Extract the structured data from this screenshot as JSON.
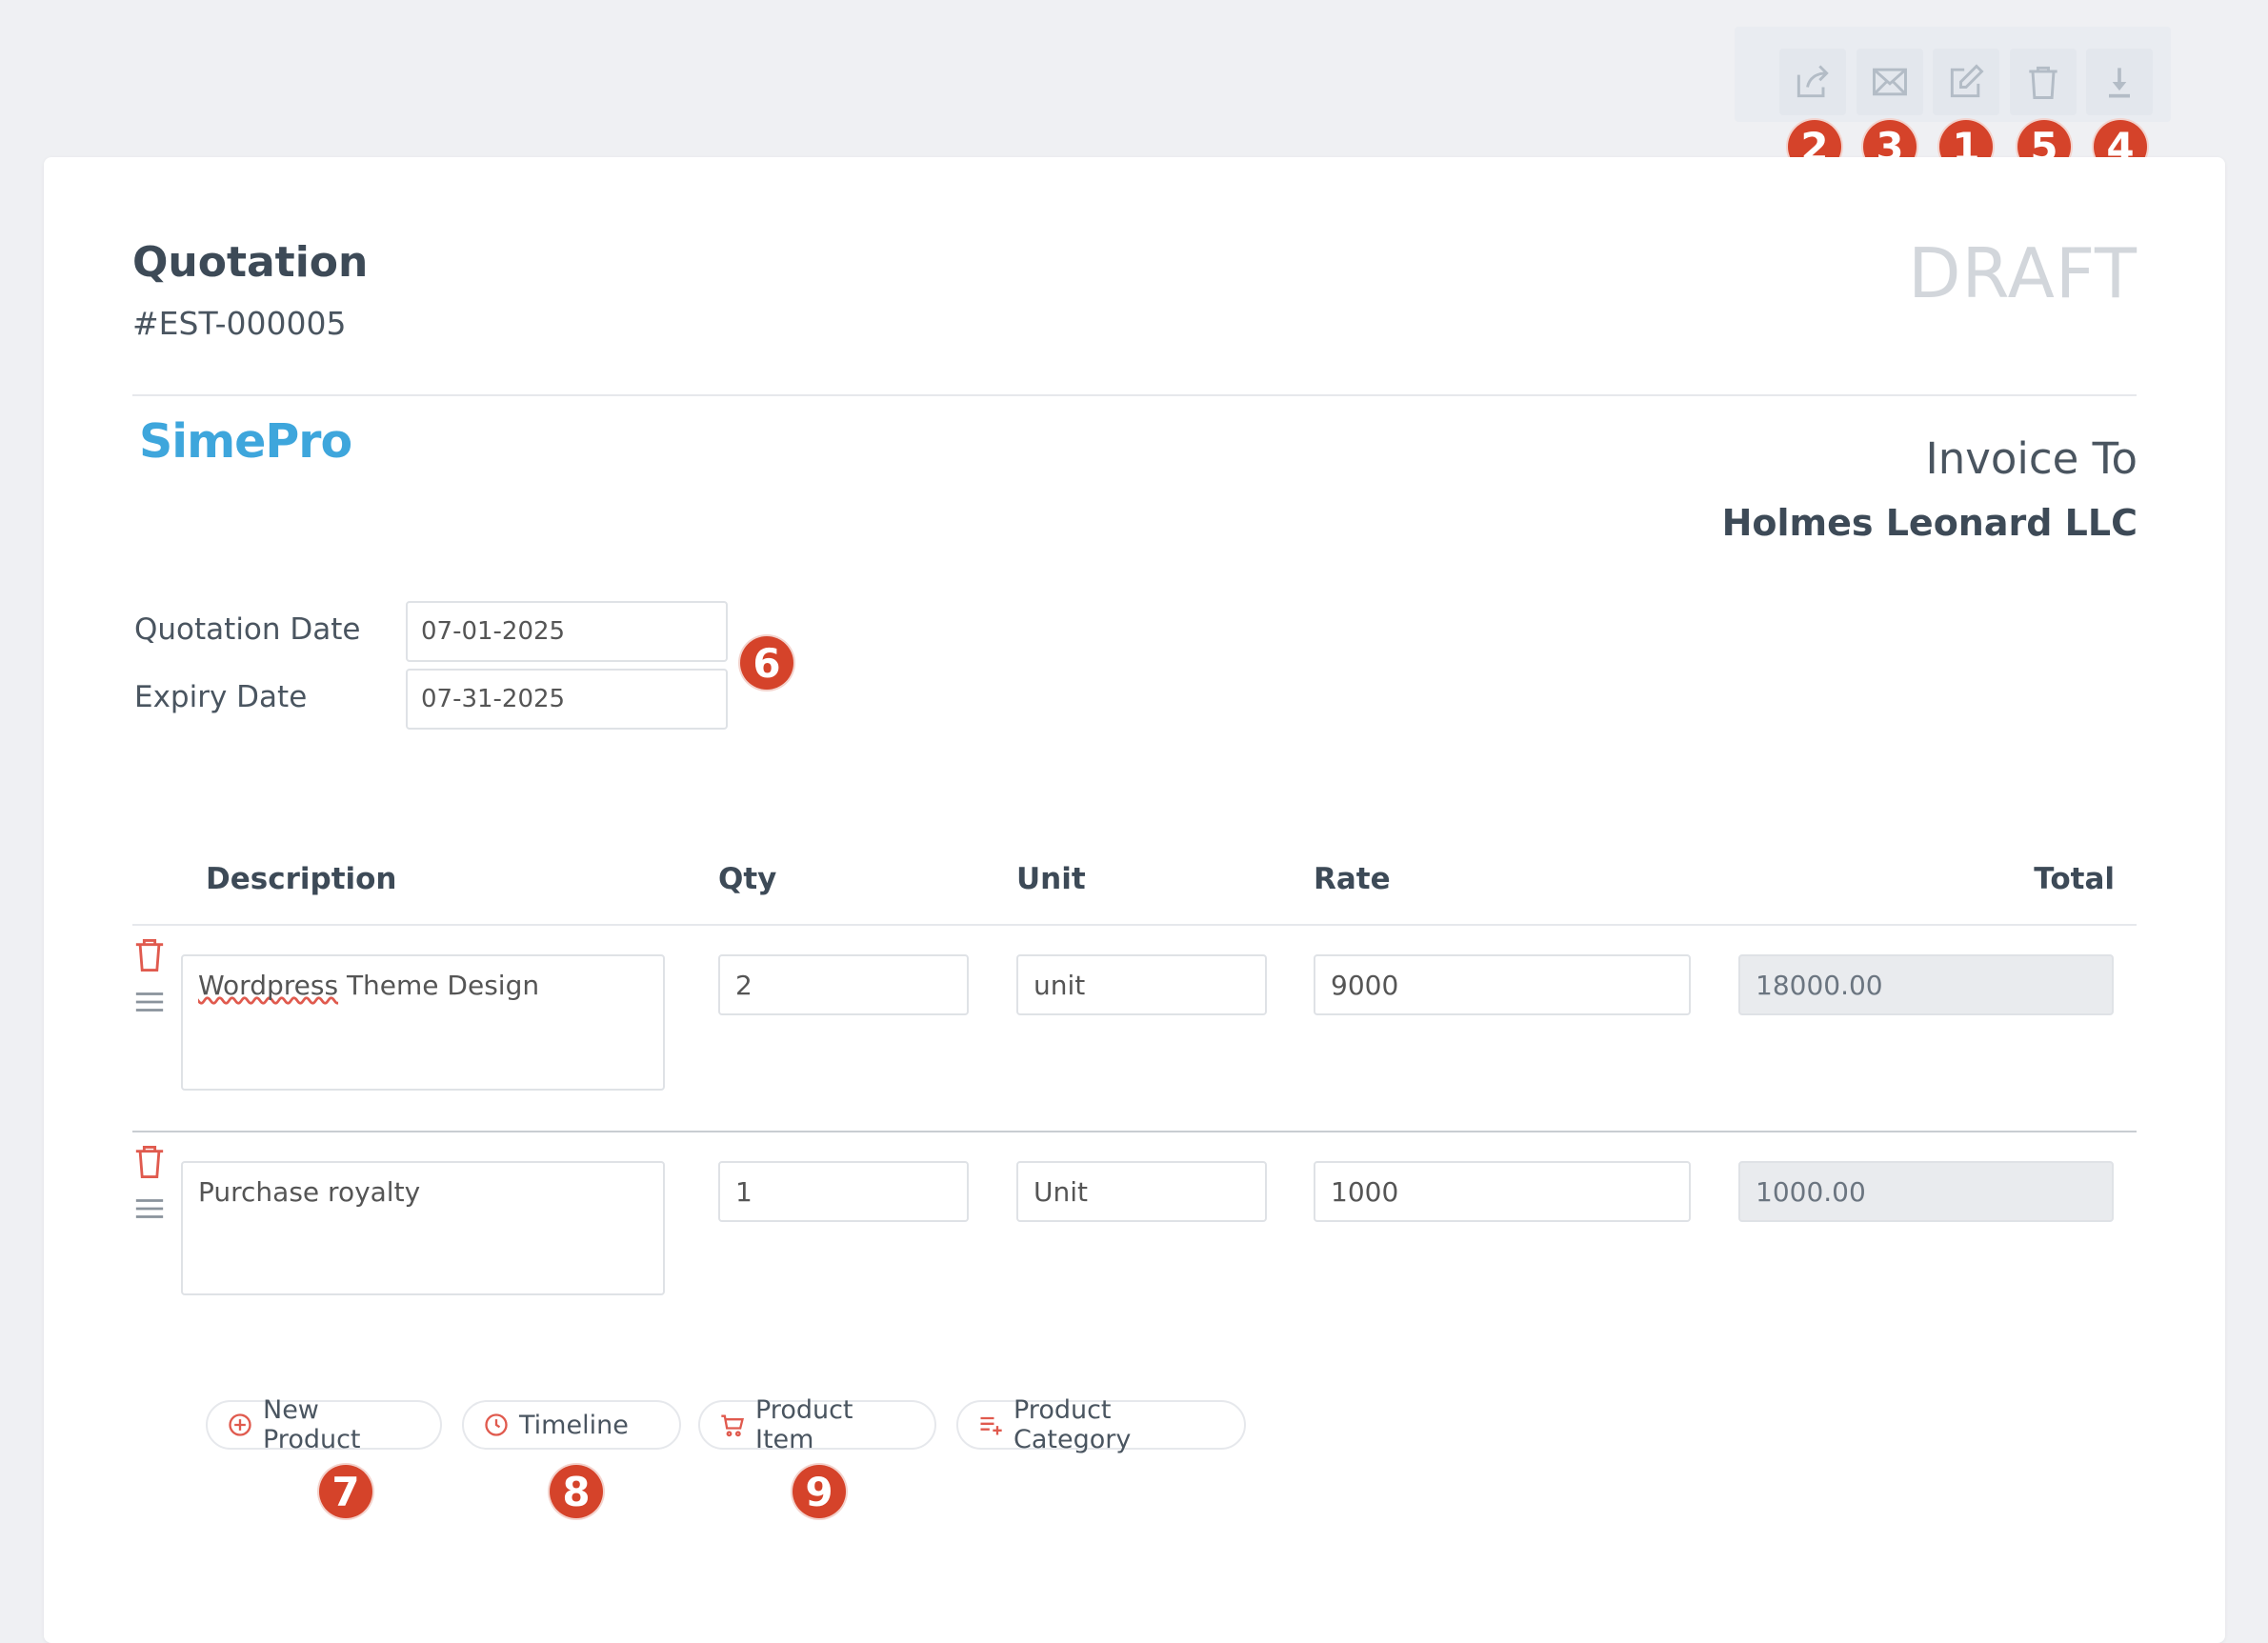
{
  "toolbar": {
    "actions": [
      {
        "name": "share",
        "icon": "share-icon",
        "marker": "2"
      },
      {
        "name": "email",
        "icon": "mail-icon",
        "marker": "3"
      },
      {
        "name": "edit",
        "icon": "edit-icon",
        "marker": "1"
      },
      {
        "name": "delete",
        "icon": "trash-icon",
        "marker": "5"
      },
      {
        "name": "download",
        "icon": "download-icon",
        "marker": "4"
      }
    ]
  },
  "document": {
    "title": "Quotation",
    "number": "#EST-000005",
    "status": "DRAFT",
    "logo_text": "SimePro",
    "invoice_to_label": "Invoice To",
    "client_name": "Holmes Leonard LLC"
  },
  "dates": {
    "quotation_label": "Quotation Date",
    "quotation_value": "07-01-2025",
    "expiry_label": "Expiry Date",
    "expiry_value": "07-31-2025",
    "marker": "6"
  },
  "table": {
    "headers": {
      "description": "Description",
      "qty": "Qty",
      "unit": "Unit",
      "rate": "Rate",
      "total": "Total"
    },
    "rows": [
      {
        "description": "Wordpress Theme Design",
        "qty": "2",
        "unit": "unit",
        "rate": "9000",
        "total": "18000.00"
      },
      {
        "description": "Purchase royalty",
        "qty": "1",
        "unit": "Unit",
        "rate": "1000",
        "total": "1000.00"
      }
    ]
  },
  "bottom_actions": [
    {
      "label": "New Product",
      "icon": "plus-circle-icon",
      "marker": "7"
    },
    {
      "label": "Timeline",
      "icon": "clock-icon",
      "marker": "8"
    },
    {
      "label": "Product Item",
      "icon": "cart-icon",
      "marker": "9"
    },
    {
      "label": "Product Category",
      "icon": "playlist-add-icon"
    }
  ],
  "colors": {
    "page_bg": "#eff0f3",
    "accent_logo": "#3ea6dc",
    "marker": "#d5432a",
    "danger_icon": "#e05a4e",
    "draft_text": "#d2d6db"
  }
}
